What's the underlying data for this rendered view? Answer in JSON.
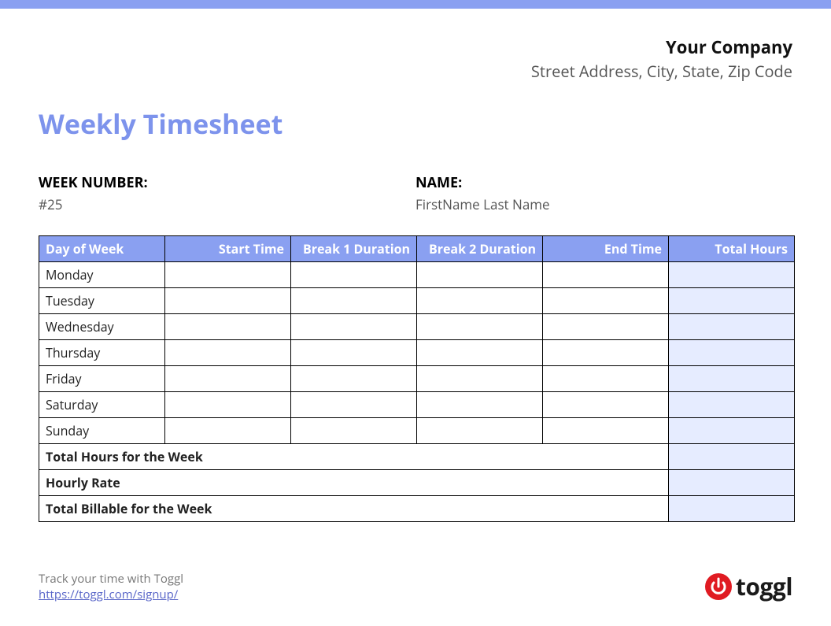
{
  "company": {
    "name": "Your Company",
    "address": "Street Address, City, State, Zip Code"
  },
  "title": "Weekly Timesheet",
  "week": {
    "label": "WEEK NUMBER:",
    "value": "#25"
  },
  "name": {
    "label": "NAME:",
    "value": "FirstName Last Name"
  },
  "headers": {
    "day": "Day of Week",
    "start": "Start Time",
    "break1": "Break 1 Duration",
    "break2": "Break 2 Duration",
    "end": "End Time",
    "total": "Total Hours"
  },
  "days": {
    "0": "Monday",
    "1": "Tuesday",
    "2": "Wednesday",
    "3": "Thursday",
    "4": "Friday",
    "5": "Saturday",
    "6": "Sunday"
  },
  "summary": {
    "totalHours": "Total Hours for the Week",
    "hourlyRate": "Hourly Rate",
    "totalBillable": "Total Billable for the Week"
  },
  "footer": {
    "text": "Track your time with Toggl",
    "link": "https://toggl.com/signup/"
  },
  "logo": {
    "text": "toggl"
  }
}
